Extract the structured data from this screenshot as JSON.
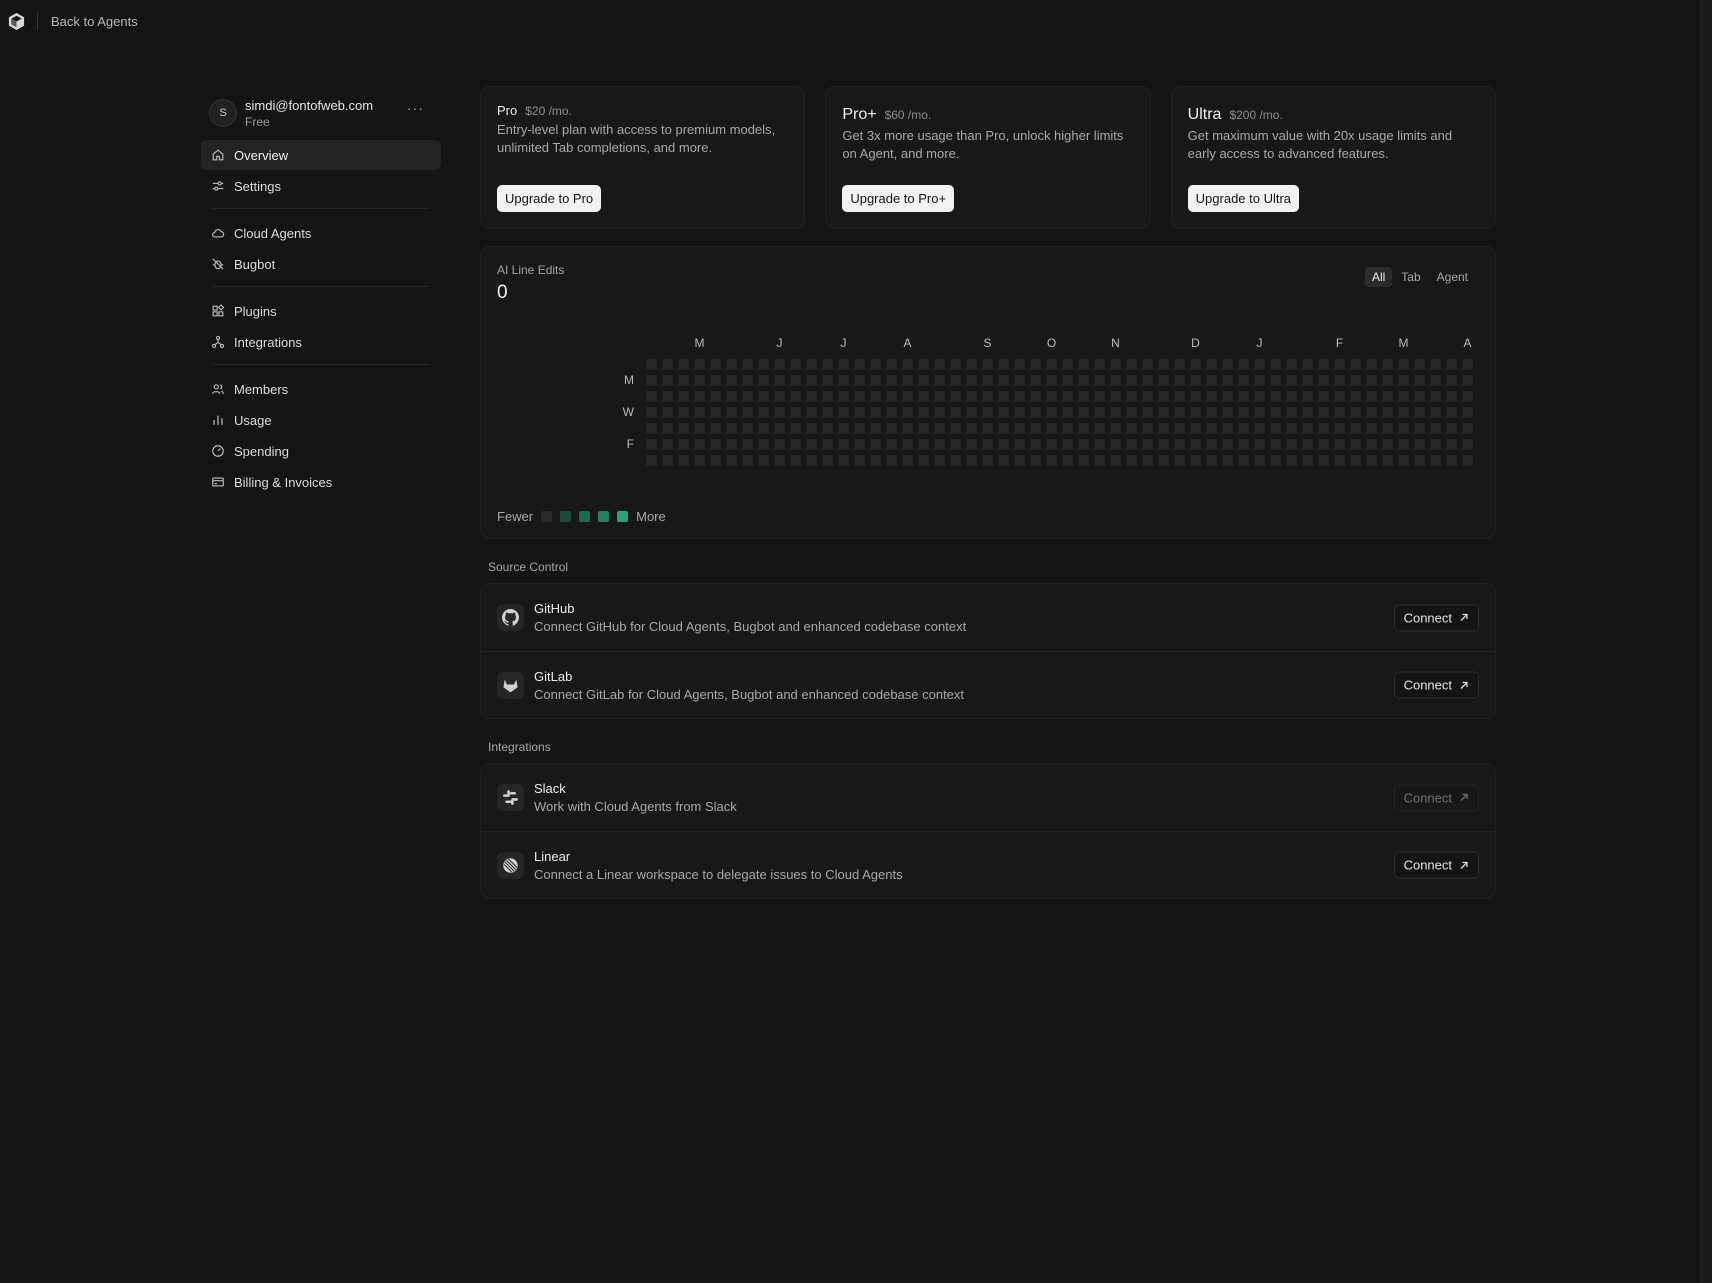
{
  "topbar": {
    "back_label": "Back to Agents"
  },
  "account": {
    "avatar_initial": "S",
    "email": "simdi@fontofweb.com",
    "plan": "Free",
    "more": "···"
  },
  "nav": {
    "overview": "Overview",
    "settings": "Settings",
    "cloud_agents": "Cloud Agents",
    "bugbot": "Bugbot",
    "plugins": "Plugins",
    "integrations": "Integrations",
    "members": "Members",
    "usage": "Usage",
    "spending": "Spending",
    "billing": "Billing & Invoices"
  },
  "plans": [
    {
      "name": "Pro",
      "price": "$20 /mo.",
      "desc": "Entry-level plan with access to premium models, unlimited Tab completions, and more.",
      "button": "Upgrade to Pro"
    },
    {
      "name": "Pro+",
      "price": "$60 /mo.",
      "desc": "Get 3x more usage than Pro, unlock higher limits on Agent, and more.",
      "button": "Upgrade to Pro+"
    },
    {
      "name": "Ultra",
      "price": "$200 /mo.",
      "desc": "Get maximum value with 20x usage limits and early access to advanced features.",
      "button": "Upgrade to Ultra"
    }
  ],
  "line_edits": {
    "label": "AI Line Edits",
    "value": "0",
    "tabs": [
      "All",
      "Tab",
      "Agent"
    ],
    "active_tab": "All",
    "months": [
      "M",
      "J",
      "J",
      "A",
      "S",
      "O",
      "N",
      "D",
      "J",
      "F",
      "M",
      "A"
    ],
    "days": [
      "M",
      "W",
      "F"
    ],
    "weeks": 54,
    "legend_fewer": "Fewer",
    "legend_more": "More",
    "legend_colors": [
      "#2a2a2a",
      "#1d4a3c",
      "#1f6a52",
      "#238062",
      "#2aa07a"
    ],
    "empty_cell_color": "#262626"
  },
  "source_control": {
    "title": "Source Control",
    "items": [
      {
        "name": "GitHub",
        "desc": "Connect GitHub for Cloud Agents, Bugbot and enhanced codebase context",
        "button": "Connect"
      },
      {
        "name": "GitLab",
        "desc": "Connect GitLab for Cloud Agents, Bugbot and enhanced codebase context",
        "button": "Connect"
      }
    ]
  },
  "integrations": {
    "title": "Integrations",
    "items": [
      {
        "name": "Slack",
        "desc": "Work with Cloud Agents from Slack",
        "button": "Connect"
      },
      {
        "name": "Linear",
        "desc": "Connect a Linear workspace to delegate issues to Cloud Agents",
        "button": "Connect"
      }
    ]
  }
}
